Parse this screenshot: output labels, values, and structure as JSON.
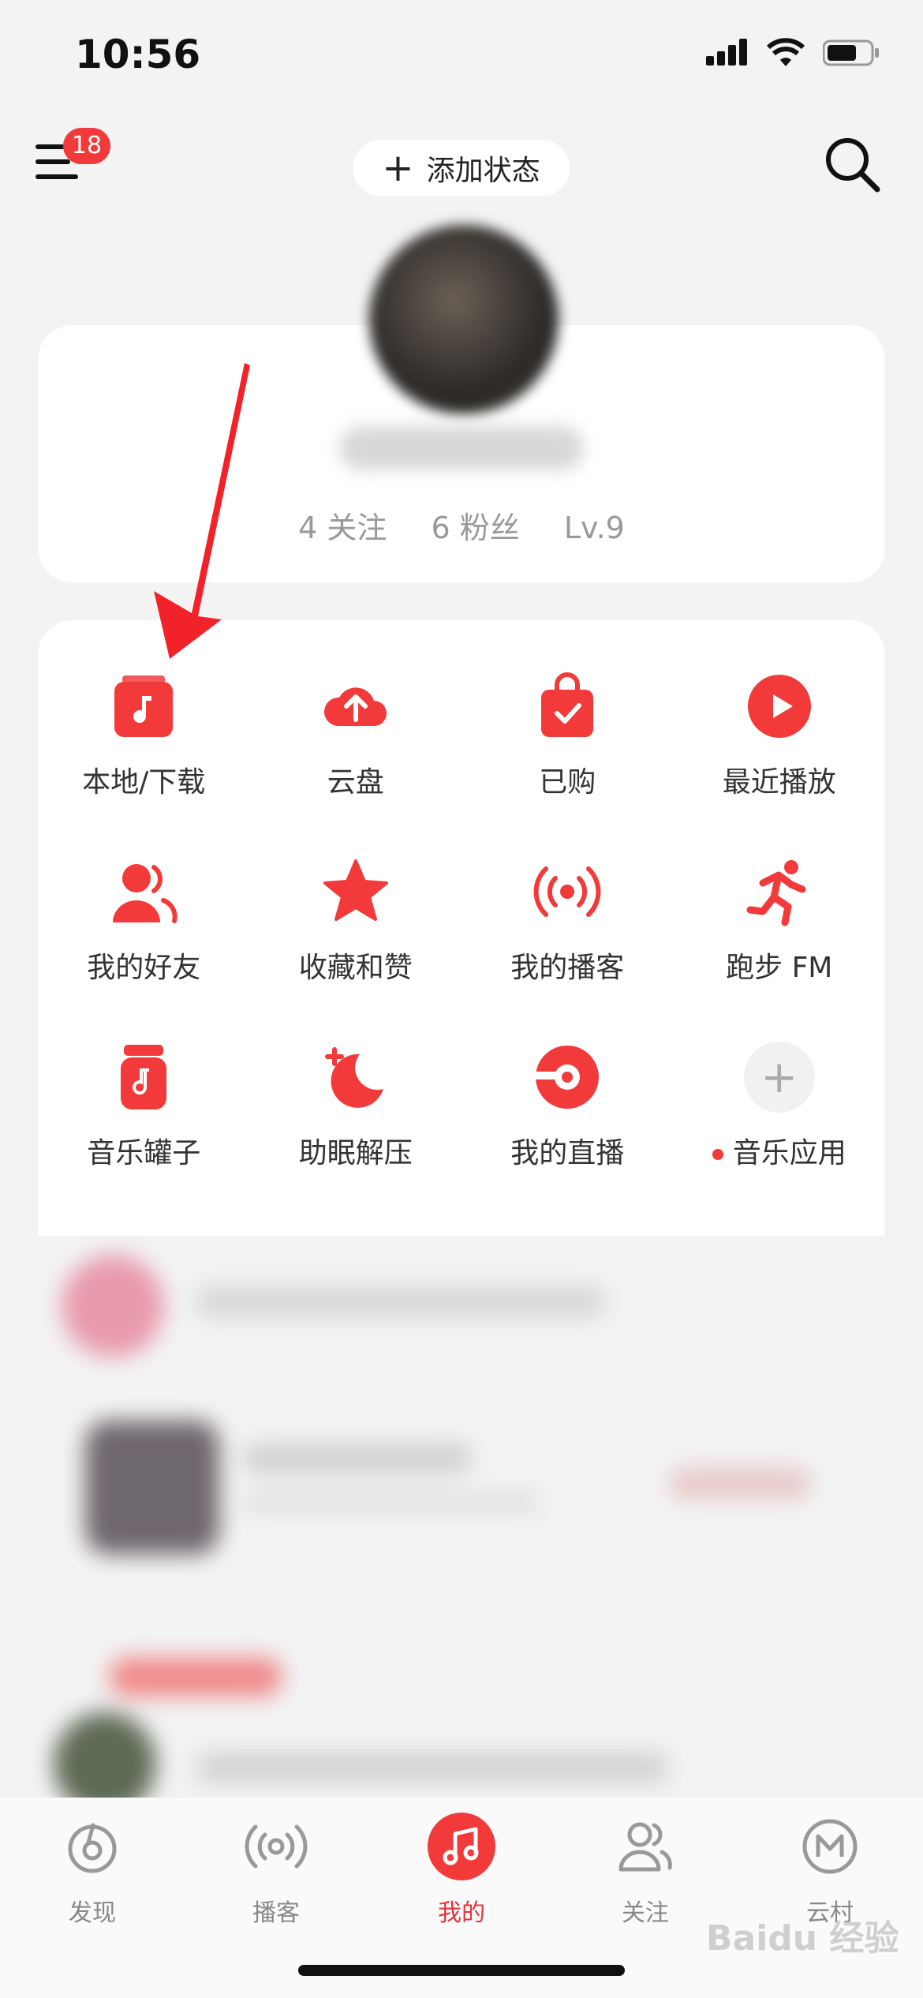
{
  "status_bar": {
    "time": "10:56"
  },
  "header": {
    "menu_badge": "18",
    "add_status_label": "添加状态"
  },
  "profile": {
    "following": "4 关注",
    "fans": "6 粉丝",
    "level": "Lv.9"
  },
  "grid_items": [
    {
      "label": "本地/下载",
      "icon": "music-folder-icon"
    },
    {
      "label": "云盘",
      "icon": "cloud-upload-icon"
    },
    {
      "label": "已购",
      "icon": "shopping-bag-icon"
    },
    {
      "label": "最近播放",
      "icon": "play-circle-icon"
    },
    {
      "label": "我的好友",
      "icon": "friends-icon"
    },
    {
      "label": "收藏和赞",
      "icon": "star-icon"
    },
    {
      "label": "我的播客",
      "icon": "broadcast-icon"
    },
    {
      "label": "跑步 FM",
      "icon": "running-icon"
    },
    {
      "label": "音乐罐子",
      "icon": "music-jar-icon"
    },
    {
      "label": "助眠解压",
      "icon": "moon-icon"
    },
    {
      "label": "我的直播",
      "icon": "live-icon"
    },
    {
      "label": "音乐应用",
      "icon": "plus-icon"
    }
  ],
  "tabs": [
    {
      "label": "发现",
      "icon": "discover-icon"
    },
    {
      "label": "播客",
      "icon": "podcast-icon"
    },
    {
      "label": "我的",
      "icon": "music-note-icon",
      "active": true
    },
    {
      "label": "关注",
      "icon": "follow-icon"
    },
    {
      "label": "云村",
      "icon": "cloud-village-icon"
    }
  ],
  "colors": {
    "accent": "#f23a3a",
    "active_tab": "#e8323c",
    "background": "#f3f3f4"
  },
  "watermark": "Baidu 经验"
}
